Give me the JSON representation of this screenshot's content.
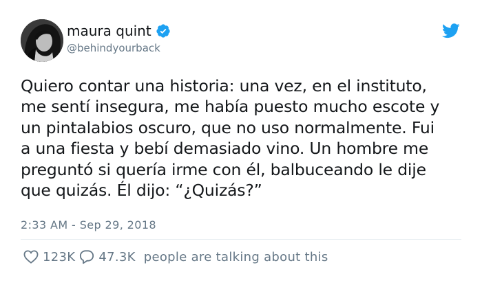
{
  "author": {
    "display_name": "maura quint",
    "handle": "@behindyourback",
    "verified": true
  },
  "tweet": {
    "lines": [
      "Quiero contar una historia: una vez, en el instituto,",
      "me sentí insegura, me había puesto mucho escote y",
      "un pintalabios oscuro, que no uso normalmente. Fui",
      "a una fiesta y bebí demasiado vino. Un hombre me",
      "preguntó si quería irme con él, balbuceando le dije",
      "que quizás. Él dijo: “¿Quizás?”"
    ],
    "timestamp": "2:33 AM - Sep 29, 2018"
  },
  "stats": {
    "likes": "123K",
    "replies": "47.3K",
    "talking_label": "people are talking about this"
  },
  "icons": {
    "verified": "verified-badge-icon",
    "brand": "twitter-bird-icon",
    "like": "heart-icon",
    "reply": "reply-bubble-icon"
  },
  "colors": {
    "brand_blue": "#1da1f2",
    "text_primary": "#14171a",
    "text_secondary": "#657786"
  }
}
